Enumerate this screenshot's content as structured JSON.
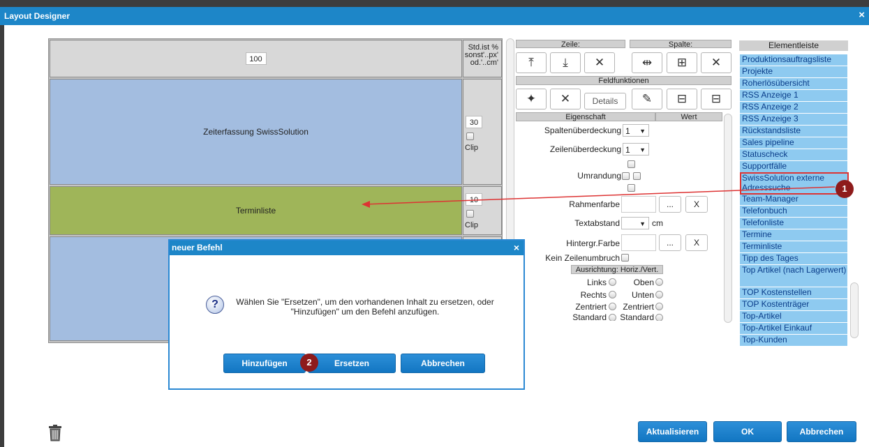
{
  "window": {
    "title": "Layout Designer",
    "close": "×"
  },
  "grid": {
    "row1": {
      "value": "100",
      "side": "Std.ist %\nsonst'..px'\nod.'..cm'"
    },
    "row2": {
      "label": "Zeiterfassung SwissSolution",
      "height": "30",
      "clip": "Clip"
    },
    "row3": {
      "label": "Terminliste",
      "height": "10",
      "clip": "Clip"
    }
  },
  "toolbar": {
    "zeile": "Zeile:",
    "spalte": "Spalte:",
    "feldfunktionen": "Feldfunktionen",
    "details": "Details",
    "delete": "✕"
  },
  "props": {
    "eigenschaft": "Eigenschaft",
    "wert": "Wert",
    "spaltenueberdeckung": "Spaltenüberdeckung",
    "zeilenueberdeckung": "Zeilenüberdeckung",
    "ueberdeckung_value": "1",
    "umrandung": "Umrandung",
    "rahmenfarbe": "Rahmenfarbe",
    "textabstand": "Textabstand",
    "cm": "cm",
    "hintergrfarbe": "Hintergr.Farbe",
    "kein_zeilenumbruch": "Kein Zeilenumbruch",
    "ausrichtung": "Ausrichtung: Horiz./Vert.",
    "links": "Links",
    "oben": "Oben",
    "rechts": "Rechts",
    "unten": "Unten",
    "zentriert_h": "Zentriert",
    "zentriert_v": "Zentriert",
    "standard_h": "Standard",
    "standard_v": "Standard",
    "ellipsis": "...",
    "x": "X"
  },
  "elementleiste": {
    "title": "Elementleiste",
    "items": [
      "Produktionsauftragsliste",
      "Projekte",
      "Roherlösübersicht",
      "RSS Anzeige 1",
      "RSS Anzeige 2",
      "RSS Anzeige 3",
      "Rückstandsliste",
      "Sales pipeline",
      "Statuscheck",
      "Supportfälle",
      "SwissSolution externe Adresssuche",
      "Team-Manager",
      "Telefonbuch",
      "Telefonliste",
      "Termine",
      "Terminliste",
      "Tipp des Tages",
      "Top Artikel (nach Lagerwert)",
      "TOP Kostenstellen",
      "TOP Kostenträger",
      "Top-Artikel",
      "Top-Artikel Einkauf",
      "Top-Kunden"
    ]
  },
  "dialog": {
    "title": "neuer Befehl",
    "close": "×",
    "message_line1": "Wählen Sie \"Ersetzen\", um den vorhandenen Inhalt zu ersetzen, oder",
    "message_line2": "\"Hinzufügen\" um den Befehl anzufügen.",
    "add": "Hinzufügen",
    "replace": "Ersetzen",
    "cancel": "Abbrechen"
  },
  "badges": {
    "one": "1",
    "two": "2"
  },
  "footer": {
    "refresh": "Aktualisieren",
    "ok": "OK",
    "cancel": "Abbrechen"
  },
  "colors": {
    "title_blue": "#1d86c8",
    "list_blue": "#8ecaf0",
    "button_blue": "#1a7fcb",
    "annotation_red": "#d33",
    "badge": "#8e1b1b"
  }
}
